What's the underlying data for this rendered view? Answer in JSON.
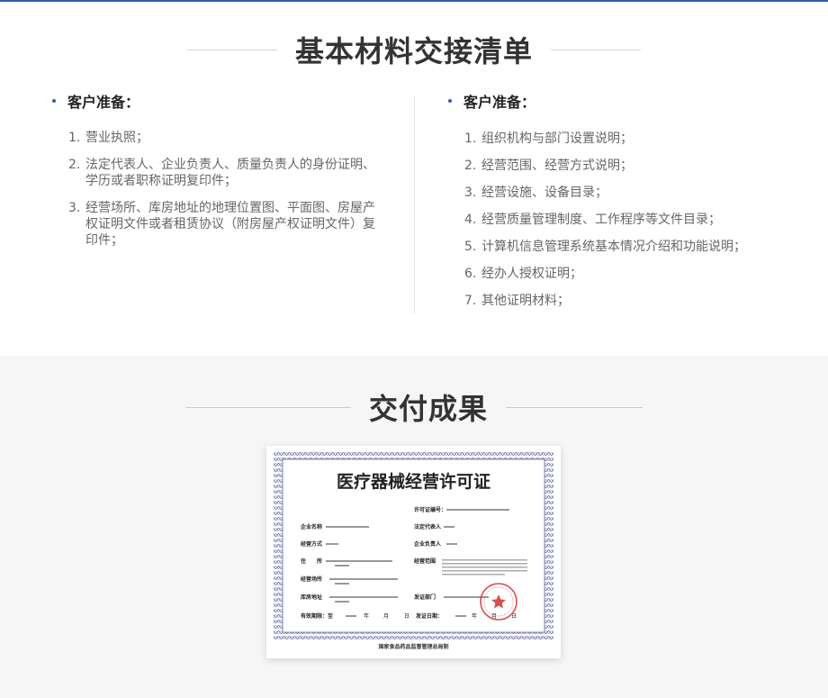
{
  "section1": {
    "heading": "基本材料交接清单",
    "left": {
      "title": "客户准备：",
      "items": [
        {
          "num": "1.",
          "text": "营业执照；"
        },
        {
          "num": "2.",
          "text": "法定代表人、企业负责人、质量负责人的身份证明、学历或者职称证明复印件；"
        },
        {
          "num": "3.",
          "text": "经营场所、库房地址的地理位置图、平面图、房屋产权证明文件或者租赁协议（附房屋产权证明文件）复印件；"
        }
      ]
    },
    "right": {
      "title": "客户准备：",
      "items": [
        {
          "num": "1.",
          "text": "组织机构与部门设置说明；"
        },
        {
          "num": "2.",
          "text": "经营范围、经营方式说明；"
        },
        {
          "num": "3.",
          "text": "经营设施、设备目录；"
        },
        {
          "num": "4.",
          "text": "经营质量管理制度、工作程序等文件目录；"
        },
        {
          "num": "5.",
          "text": "计算机信息管理系统基本情况介绍和功能说明；"
        },
        {
          "num": "6.",
          "text": "经办人授权证明；"
        },
        {
          "num": "7.",
          "text": "其他证明材料；"
        }
      ]
    }
  },
  "section2": {
    "heading": "交付成果",
    "certificate": {
      "title": "医疗器械经营许可证",
      "license_no_label": "许可证编号：",
      "company_label": "企业名称",
      "legal_rep_label": "法定代表人",
      "method_label": "经营方式",
      "principal_label": "企业负责人",
      "address_label": "住　　所",
      "scope_label": "经营范围",
      "site_label": "经营场所",
      "warehouse_label": "库房地址",
      "issuer_label": "发证部门",
      "valid_label": "有效期限：至",
      "issue_date_label": "发证日期：",
      "year_char": "年",
      "month_char": "月",
      "day_char": "日",
      "footer": "国家食品药品监督管理总局制"
    }
  }
}
